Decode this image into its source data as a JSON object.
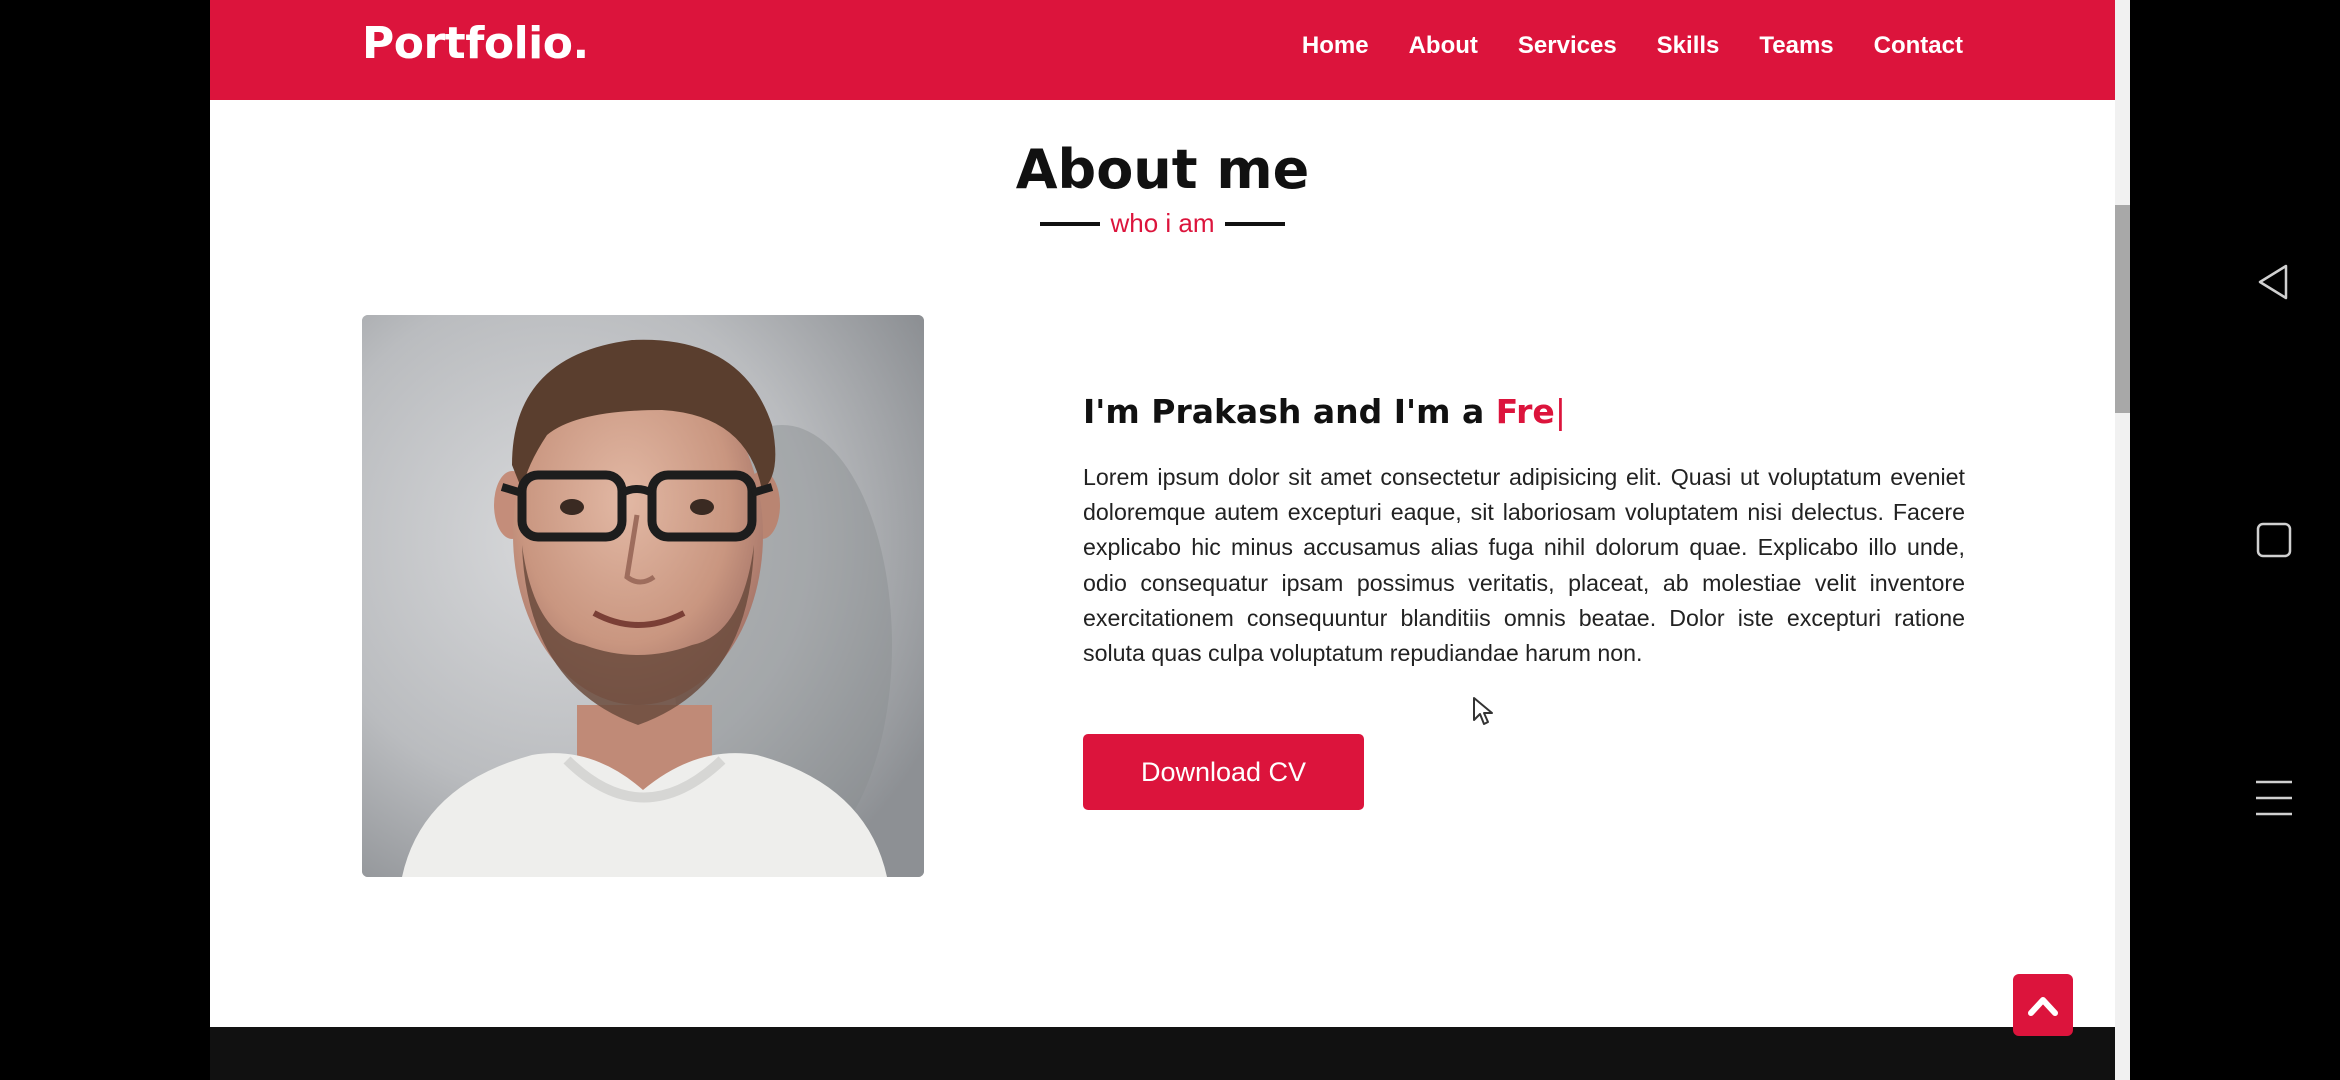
{
  "navbar": {
    "logo": "Portfolio.",
    "items": [
      "Home",
      "About",
      "Services",
      "Skills",
      "Teams",
      "Contact"
    ]
  },
  "about": {
    "title": "About me",
    "subtitle": "who i am",
    "headline_prefix": "I'm Prakash and I'm a ",
    "headline_typed": "Fre",
    "caret": "|",
    "paragraph": "Lorem ipsum dolor sit amet consectetur adipisicing elit. Quasi ut voluptatum eveniet doloremque autem excepturi eaque, sit laboriosam voluptatem nisi delectus. Facere explicabo hic minus accusamus alias fuga nihil dolorum quae. Explicabo illo unde, odio consequatur ipsam possimus veritatis, placeat, ab molestiae velit inventore exercitationem consequuntur blanditiis omnis beatae. Dolor iste excepturi ratione soluta quas culpa voluptatum repudiandae harum non.",
    "download_button": "Download CV"
  },
  "icons": {
    "scroll_top": "chevron-up-icon",
    "back": "back-triangle-icon",
    "home": "home-square-icon",
    "menu": "menu-lines-icon"
  },
  "colors": {
    "accent": "#dc143c",
    "text": "#111111",
    "background": "#ffffff",
    "footer": "#111111"
  }
}
